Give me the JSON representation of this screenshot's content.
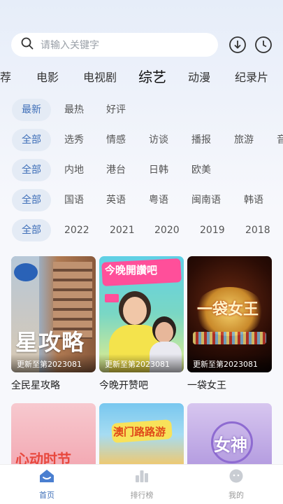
{
  "search": {
    "placeholder": "请输入关键字"
  },
  "header": {
    "download_icon": "download-icon",
    "history_icon": "clock-icon"
  },
  "category_tabs": [
    {
      "label": "荐"
    },
    {
      "label": "电影"
    },
    {
      "label": "电视剧"
    },
    {
      "label": "综艺",
      "active": true
    },
    {
      "label": "动漫"
    },
    {
      "label": "纪录片"
    }
  ],
  "filters": {
    "sort": [
      "最新",
      "最热",
      "好评"
    ],
    "type": [
      "全部",
      "选秀",
      "情感",
      "访谈",
      "播报",
      "旅游",
      "音"
    ],
    "region": [
      "全部",
      "内地",
      "港台",
      "日韩",
      "欧美"
    ],
    "language": [
      "全部",
      "国语",
      "英语",
      "粤语",
      "闽南语",
      "韩语"
    ],
    "year": [
      "全部",
      "2022",
      "2021",
      "2020",
      "2019",
      "2018"
    ]
  },
  "cards": [
    {
      "title": "全民星攻略",
      "badge": "更新至第2023081",
      "poster_text": "星攻略"
    },
    {
      "title": "今晚开赞吧",
      "badge": "更新至第2023081",
      "poster_text": "今晚開讚吧"
    },
    {
      "title": "一袋女王",
      "badge": "更新至第2023081",
      "poster_text": "一袋女王"
    }
  ],
  "row2_posters": [
    "心动时节",
    "澳门路路游",
    "女神"
  ],
  "tabbar": [
    {
      "label": "首页",
      "icon": "home-icon",
      "active": true
    },
    {
      "label": "排行榜",
      "icon": "bar-chart-icon"
    },
    {
      "label": "我的",
      "icon": "user-icon"
    }
  ],
  "colors": {
    "accent": "#3f6fb8",
    "chip_bg": "#e4ebf5"
  }
}
